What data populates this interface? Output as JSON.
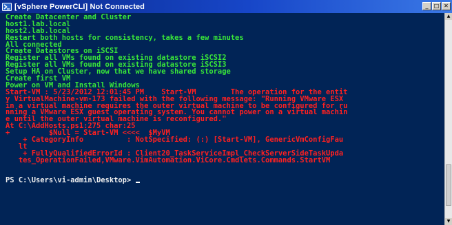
{
  "window": {
    "title": "[vSphere PowerCLI] Not Connected",
    "buttons": {
      "minimize": "_",
      "maximize": "□",
      "close": "✕"
    }
  },
  "console": {
    "lines": [
      {
        "text": "Create Datacenter and Cluster",
        "color": "green"
      },
      {
        "text": "host1.lab.local",
        "color": "green"
      },
      {
        "text": "host2.lab.local",
        "color": "green"
      },
      {
        "text": "Restart both hosts for consistency, takes a few minutes",
        "color": "green"
      },
      {
        "text": "All connected",
        "color": "green"
      },
      {
        "text": "Create Datastores on iSCSI",
        "color": "green"
      },
      {
        "text": "Register all VMs found on existing datastore iSCSI2",
        "color": "green"
      },
      {
        "text": "Register all VMs found on existing datastore iSCSI3",
        "color": "green"
      },
      {
        "text": "Setup HA on Cluster, now that we have shared storage",
        "color": "green"
      },
      {
        "text": "Create first VM",
        "color": "green"
      },
      {
        "text": "Power on VM and Install Windows",
        "color": "green"
      },
      {
        "text": "Start-VM : 5/23/2012 12:01:45 PM    Start-VM        The operation for the entit",
        "color": "red"
      },
      {
        "text": "y VirtualMachine-vm-173 failed with the following message: \"Running VMware ESX",
        "color": "red"
      },
      {
        "text": "in a virtual machine requires the outer virtual machine to be configured for ru",
        "color": "red"
      },
      {
        "text": "nning a VMware ESX guest operating system. You cannot power on a virtual machin",
        "color": "red"
      },
      {
        "text": "e until the outer virtual machine is reconfigured.\"",
        "color": "red"
      },
      {
        "text": "At C:\\AddHosts.ps1:275 char:25",
        "color": "red"
      },
      {
        "text": "+         $Null = Start-VM <<<<  $MyVM",
        "color": "red"
      },
      {
        "text": "    + CategoryInfo          : NotSpecified: (:) [Start-VM], GenericVmConfigFau",
        "color": "red"
      },
      {
        "text": "   lt",
        "color": "red"
      },
      {
        "text": "    + FullyQualifiedErrorId : Client20_TaskServiceImpl_CheckServerSideTaskUpda",
        "color": "red"
      },
      {
        "text": "   tes_OperationFailed,VMware.VimAutomation.ViCore.Cmdlets.Commands.StartVM",
        "color": "red"
      },
      {
        "text": "",
        "color": "white"
      },
      {
        "text": "",
        "color": "white"
      },
      {
        "text": "PS C:\\Users\\vi-admin\\Desktop> ",
        "color": "white",
        "cursor": true
      }
    ]
  },
  "colors": {
    "background": "#012456",
    "green": "#39e639",
    "red": "#ff2020",
    "white": "#f0f0f0"
  }
}
